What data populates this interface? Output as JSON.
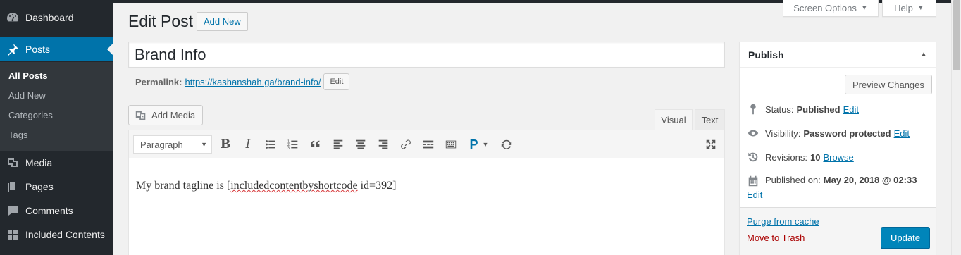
{
  "sidebar": {
    "items": [
      {
        "label": "Dashboard",
        "icon": "dashboard-icon"
      },
      {
        "label": "Posts",
        "icon": "pushpin-icon"
      },
      {
        "label": "Media",
        "icon": "media-icon"
      },
      {
        "label": "Pages",
        "icon": "pages-icon"
      },
      {
        "label": "Comments",
        "icon": "comments-icon"
      },
      {
        "label": "Included Contents",
        "icon": "included-contents-icon"
      }
    ],
    "submenu": [
      "All Posts",
      "Add New",
      "Categories",
      "Tags"
    ]
  },
  "screen_options": {
    "label": "Screen Options"
  },
  "help": {
    "label": "Help"
  },
  "header": {
    "title": "Edit Post",
    "add_new": "Add New"
  },
  "post": {
    "title": "Brand Info",
    "permalink_label": "Permalink:",
    "permalink_url": "https://kashanshah.ga/brand-info/",
    "permalink_edit": "Edit"
  },
  "editor": {
    "add_media": "Add Media",
    "tabs": [
      "Visual",
      "Text"
    ],
    "format": "Paragraph",
    "content_before": "My brand tagline is [",
    "content_spell": "includedcontentbyshortcode",
    "content_after": " id=392]"
  },
  "publish": {
    "title": "Publish",
    "preview": "Preview Changes",
    "status_label": "Status:",
    "status_value": "Published",
    "visibility_label": "Visibility:",
    "visibility_value": "Password protected",
    "revisions_label": "Revisions:",
    "revisions_value": "10",
    "browse": "Browse",
    "published_label": "Published on:",
    "published_value": "May 20, 2018 @ 02:33",
    "edit": "Edit",
    "purge": "Purge from cache",
    "trash": "Move to Trash",
    "update": "Update"
  },
  "colors": {
    "accent": "#0073aa",
    "sidebar": "#23282d",
    "button_primary": "#0085ba",
    "trash": "#aa0000"
  }
}
